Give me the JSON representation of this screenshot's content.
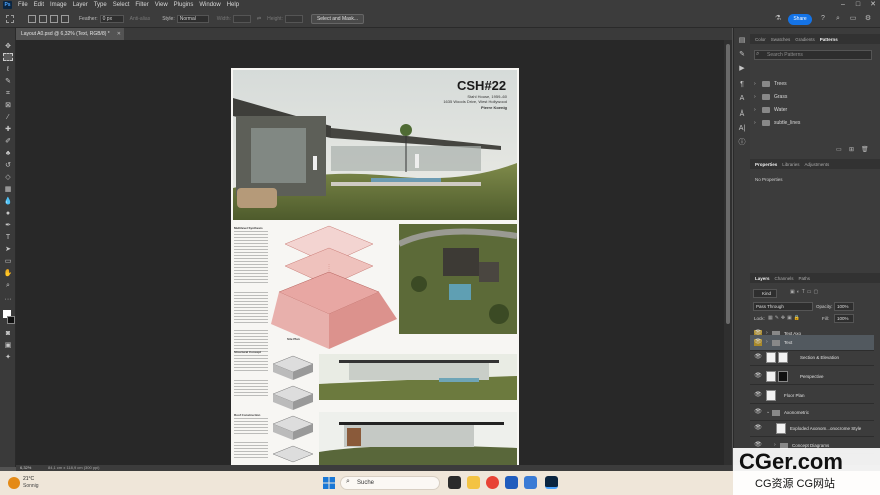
{
  "app": {
    "logo": "Ps",
    "menu": [
      "File",
      "Edit",
      "Image",
      "Layer",
      "Type",
      "Select",
      "Filter",
      "View",
      "Plugins",
      "Window",
      "Help"
    ]
  },
  "options_bar": {
    "feather_label": "Feather:",
    "feather_value": "0 px",
    "anti_alias": "Anti-alias",
    "style_label": "Style:",
    "style_value": "Normal",
    "width_label": "Width:",
    "height_label": "Height:",
    "select_mask_button": "Select and Mask...",
    "share_button": "Share"
  },
  "document": {
    "tab_title": "Layout A0.psd @ 6,32% (Text, RGB/8) *",
    "status_zoom": "6,32%",
    "status_info": "84,1 cm x 118,9 cm (300 ppi)"
  },
  "poster": {
    "title": "CSH#22",
    "subtitle_1": "Stahl House, 1959–60",
    "subtitle_2": "1635 Woods Drive, West Hollywood",
    "subtitle_3": "Pierre Koenig",
    "heading_1": "Multilevel Synthesis",
    "heading_2": "Site Plan",
    "heading_3": "Structural Concept",
    "heading_4": "Roof Construction"
  },
  "patterns_panel": {
    "tabs": [
      "Color",
      "Swatches",
      "Gradients",
      "Patterns"
    ],
    "search_placeholder": "Search Patterns",
    "groups": [
      "Trees",
      "Grass",
      "Water",
      "subtle_lines"
    ]
  },
  "properties_panel": {
    "tabs": [
      "Properties",
      "Libraries",
      "Adjustments"
    ],
    "empty_text": "No Properties"
  },
  "layers_panel": {
    "tabs": [
      "Layers",
      "Channels",
      "Paths"
    ],
    "filter_kind": "Kind",
    "blend_mode": "Pass Through",
    "opacity_label": "Opacity:",
    "opacity_value": "100%",
    "lock_label": "Lock:",
    "fill_label": "Fill:",
    "fill_value": "100%",
    "layers": [
      {
        "name": "Text Axo"
      },
      {
        "name": "Text"
      },
      {
        "name": "Section & Elevation"
      },
      {
        "name": "Perspective"
      },
      {
        "name": "Floor Plan"
      },
      {
        "name": "Axonometric"
      },
      {
        "name": "Exploded Axonom...onocrome Style"
      },
      {
        "name": "Concept Diagrams"
      }
    ]
  },
  "taskbar": {
    "temperature": "21°C",
    "condition": "Sonnig",
    "search_placeholder": "Suche"
  },
  "watermark": {
    "main": "CGer.com",
    "sub": "CG资源 CG网站"
  },
  "colors": {
    "accent_blue": "#1473e6",
    "layer_eye_highlight": "#a8892a",
    "axo_pink": "#e8a7a3"
  }
}
